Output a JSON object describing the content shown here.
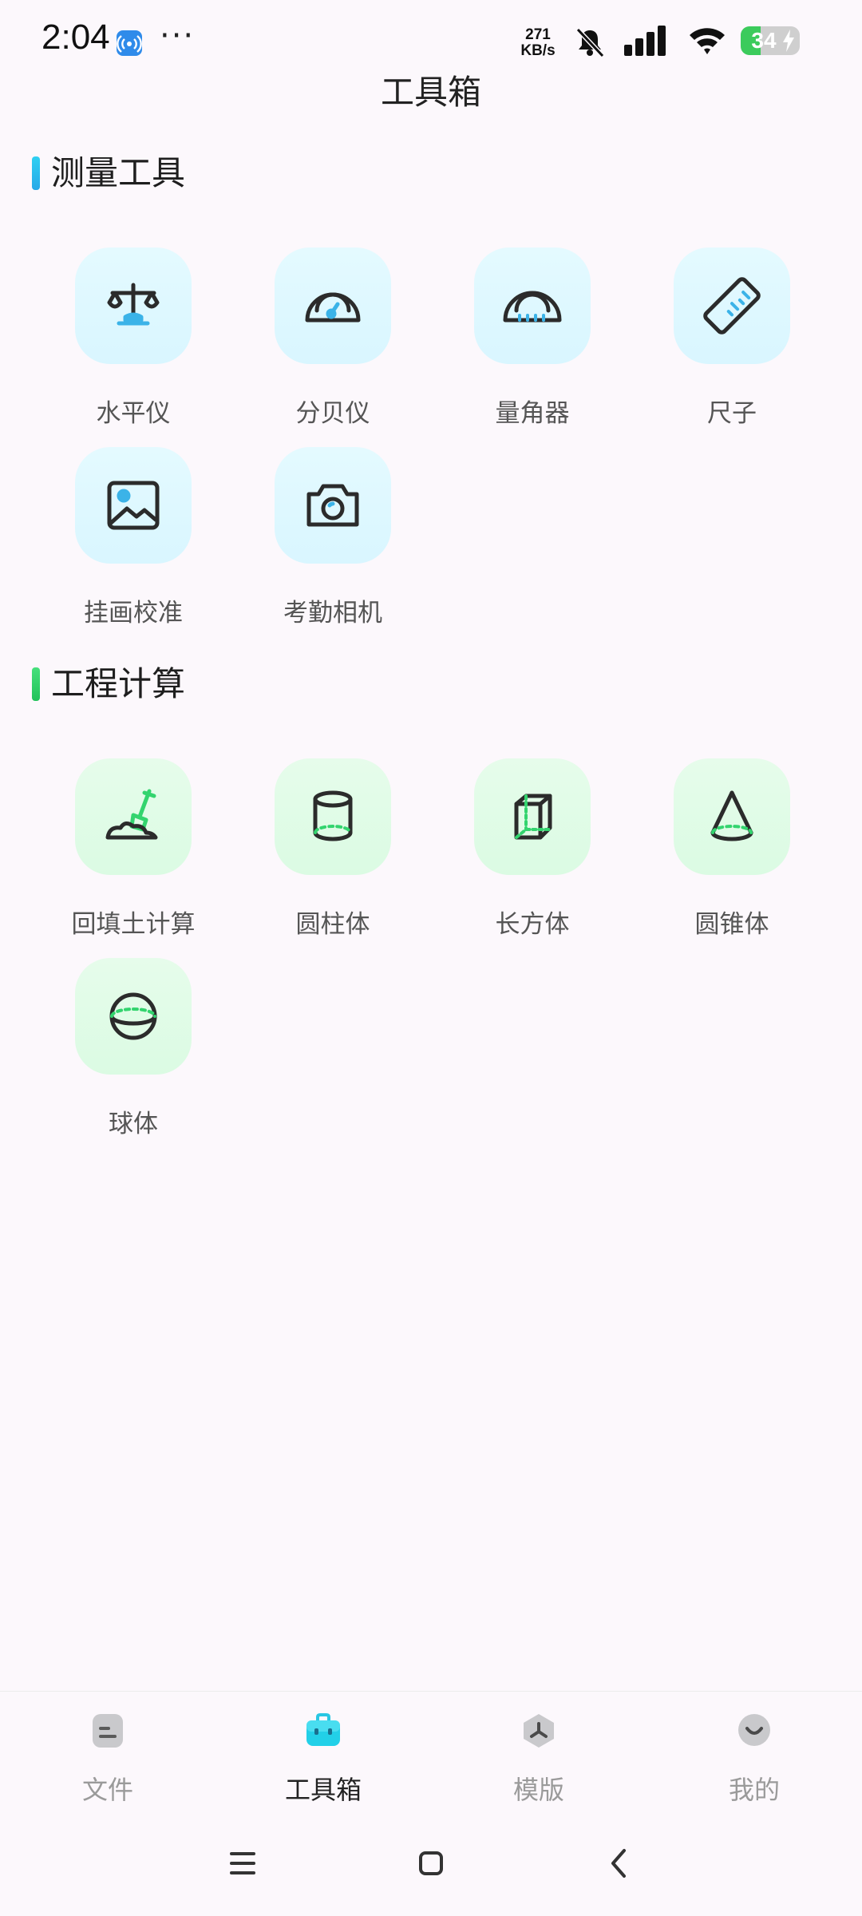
{
  "status_bar": {
    "time": "2:04",
    "more_dots": "···",
    "net_speed_value": "271",
    "net_speed_unit": "KB/s",
    "battery_level": "34",
    "battery_percent": 34,
    "icons": [
      "hotspot-icon",
      "bell-muted-icon",
      "signal-icon",
      "wifi-icon",
      "battery-icon"
    ]
  },
  "page": {
    "title": "工具箱"
  },
  "sections": {
    "measure": {
      "title": "测量工具",
      "accent": "#2EC3F0",
      "items": [
        {
          "label": "水平仪",
          "icon": "level-scale-icon"
        },
        {
          "label": "分贝仪",
          "icon": "decibel-gauge-icon"
        },
        {
          "label": "量角器",
          "icon": "protractor-icon"
        },
        {
          "label": "尺子",
          "icon": "ruler-icon"
        },
        {
          "label": "挂画校准",
          "icon": "picture-frame-icon"
        },
        {
          "label": "考勤相机",
          "icon": "camera-icon"
        }
      ]
    },
    "engineering": {
      "title": "工程计算",
      "accent": "#33D46E",
      "items": [
        {
          "label": "回填土计算",
          "icon": "shovel-soil-icon"
        },
        {
          "label": "圆柱体",
          "icon": "cylinder-icon"
        },
        {
          "label": "长方体",
          "icon": "cuboid-icon"
        },
        {
          "label": "圆锥体",
          "icon": "cone-icon"
        },
        {
          "label": "球体",
          "icon": "sphere-icon"
        }
      ]
    }
  },
  "bottom_nav": {
    "active": "toolbox",
    "items": [
      {
        "label": "文件",
        "icon": "file-icon"
      },
      {
        "label": "工具箱",
        "icon": "toolbox-icon"
      },
      {
        "label": "模版",
        "icon": "template-icon"
      },
      {
        "label": "我的",
        "icon": "profile-icon"
      }
    ]
  },
  "system_nav": [
    "menu-icon",
    "home-icon",
    "back-icon"
  ],
  "colors": {
    "background": "#FCF8FC",
    "measure_accent": "#2EC3F0",
    "engineering_accent": "#33D46E",
    "icon_stroke": "#2B2B2B"
  }
}
